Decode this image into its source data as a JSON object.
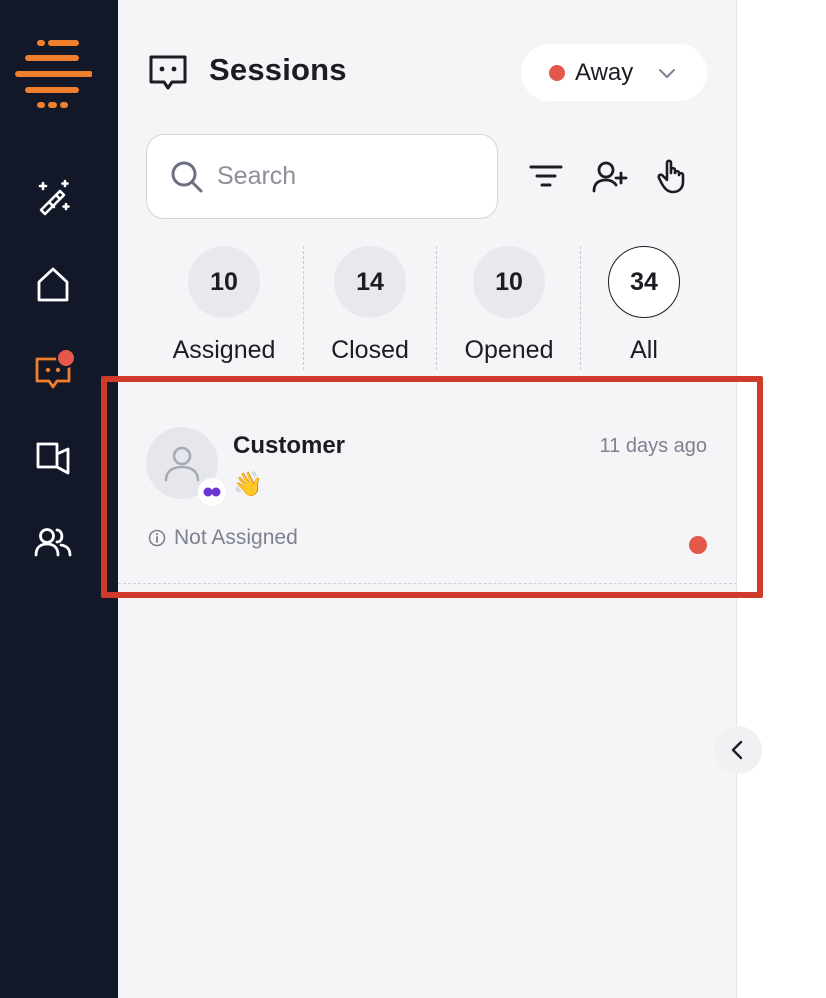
{
  "header": {
    "title": "Sessions",
    "status": {
      "label": "Away",
      "color": "#e4574b"
    }
  },
  "search": {
    "placeholder": "Search",
    "value": ""
  },
  "toolbar": {
    "icons": [
      "filter-icon",
      "assign-user-icon",
      "hand-pointer-icon"
    ]
  },
  "tabs": [
    {
      "label": "Assigned",
      "count": "10",
      "active": false
    },
    {
      "label": "Closed",
      "count": "14",
      "active": false
    },
    {
      "label": "Opened",
      "count": "10",
      "active": false
    },
    {
      "label": "All",
      "count": "34",
      "active": true
    }
  ],
  "sessions": [
    {
      "name": "Customer",
      "message": "👋",
      "time": "11 days ago",
      "assignment": "Not Assigned",
      "unread": true
    }
  ],
  "sidebar": {
    "items": [
      {
        "icon": "magic-wand-icon"
      },
      {
        "icon": "home-icon"
      },
      {
        "icon": "chat-icon",
        "active": true,
        "notification": true
      },
      {
        "icon": "megaphone-icon"
      },
      {
        "icon": "users-icon"
      }
    ]
  },
  "colors": {
    "sidebar_bg": "#121828",
    "accent": "#f07f2e",
    "alert": "#e4574b",
    "highlight": "#cf3b2b"
  }
}
